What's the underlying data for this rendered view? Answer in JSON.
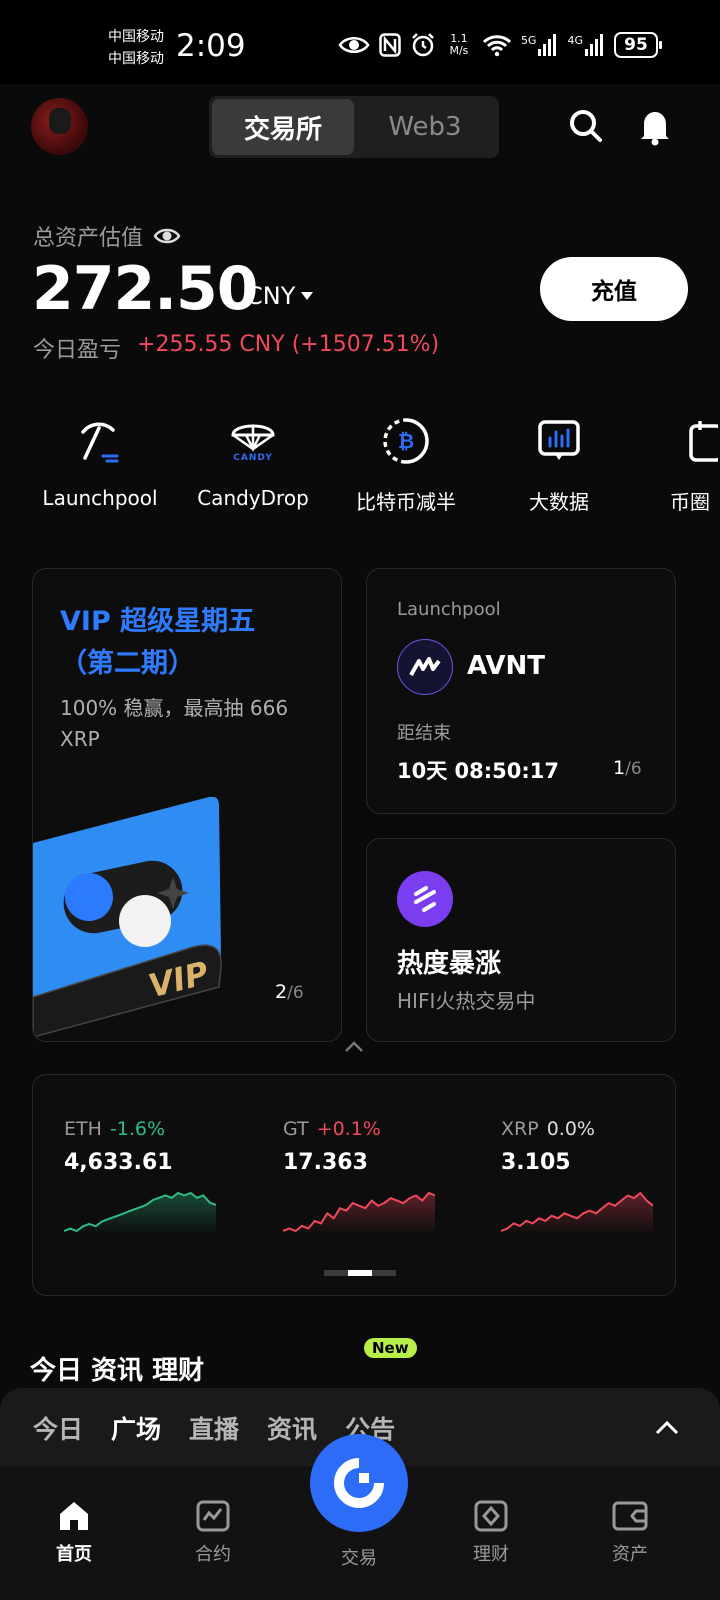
{
  "status_bar": {
    "carrier_1": "中国移动",
    "carrier_2": "中国移动",
    "time": "2:09",
    "net_speed_value": "1.1",
    "net_speed_unit": "M/s",
    "signal_1": "5G",
    "signal_2": "4G",
    "battery": "95"
  },
  "header": {
    "tabs": [
      {
        "label": "交易所",
        "active": true
      },
      {
        "label": "Web3",
        "active": false
      }
    ],
    "icons": [
      "search-icon",
      "bell-icon"
    ]
  },
  "assets": {
    "label": "总资产估值",
    "value": "272.50",
    "unit": "CNY",
    "deposit_label": "充值",
    "pnl_label": "今日盈亏",
    "pnl_value": "+255.55 CNY",
    "pnl_percent": "(+1507.51%)"
  },
  "shortcuts": [
    {
      "label": "Launchpool",
      "icon": "pickaxe-icon"
    },
    {
      "label": "CandyDrop",
      "icon": "candy-parachute-icon",
      "icon_text": "CANDY"
    },
    {
      "label": "比特币减半",
      "icon": "bitcoin-halving-icon"
    },
    {
      "label": "大数据",
      "icon": "big-data-icon"
    },
    {
      "label": "币圈",
      "icon": "partial-icon"
    }
  ],
  "vip_card": {
    "title_line1": "VIP 超级星期五",
    "title_line2": "（第二期）",
    "desc": "100% 稳赢，最高抽 666 XRP",
    "badge_text": "VIP",
    "page_current": "2",
    "page_total": "/6"
  },
  "launchpool_card": {
    "label": "Launchpool",
    "coin": "AVNT",
    "ends_label": "距结束",
    "countdown": "10天 08:50:17",
    "page_current": "1",
    "page_total": "/6"
  },
  "hot_card": {
    "title": "热度暴涨",
    "subtitle": "HIFI火热交易中"
  },
  "tickers": [
    {
      "symbol": "ETH",
      "change": "-1.6%",
      "price": "4,633.61",
      "color": "#2ebd85",
      "spark": [
        3,
        4,
        3,
        5,
        6,
        5,
        7,
        8,
        9,
        10,
        11,
        12,
        13,
        14,
        16,
        17,
        18,
        17,
        19,
        18,
        19,
        17,
        18,
        15,
        14
      ]
    },
    {
      "symbol": "GT",
      "change": "+0.1%",
      "price": "17.363",
      "color": "#f0495c",
      "spark": [
        4,
        5,
        4,
        6,
        5,
        8,
        7,
        11,
        9,
        13,
        12,
        15,
        14,
        13,
        16,
        14,
        15,
        17,
        16,
        15,
        17,
        18,
        16,
        19,
        18
      ]
    },
    {
      "symbol": "XRP",
      "change": "0.0%",
      "price": "3.105",
      "color": "#f0495c",
      "spark": [
        5,
        6,
        8,
        7,
        9,
        8,
        10,
        9,
        11,
        10,
        12,
        11,
        10,
        12,
        13,
        12,
        14,
        16,
        15,
        17,
        19,
        18,
        20,
        17,
        15
      ]
    }
  ],
  "peek": {
    "text": "今日 资讯 理财",
    "new_badge": "New"
  },
  "feed_tabs": [
    {
      "label": "今日",
      "active": false
    },
    {
      "label": "广场",
      "active": true
    },
    {
      "label": "直播",
      "active": false
    },
    {
      "label": "资讯",
      "active": false
    },
    {
      "label": "公告",
      "active": false
    }
  ],
  "bottom_nav": [
    {
      "label": "首页",
      "icon": "home-icon",
      "active": true
    },
    {
      "label": "合约",
      "icon": "futures-chart-icon",
      "active": false
    },
    {
      "label": "交易",
      "icon": "gate-logo-icon",
      "active": false
    },
    {
      "label": "理财",
      "icon": "earn-diamond-icon",
      "active": false
    },
    {
      "label": "资产",
      "icon": "wallet-icon",
      "active": false
    }
  ],
  "colors": {
    "up": "#f0495c",
    "down": "#2ebd85",
    "accent": "#2c6cf6",
    "vip_blue": "#2f7bff"
  }
}
